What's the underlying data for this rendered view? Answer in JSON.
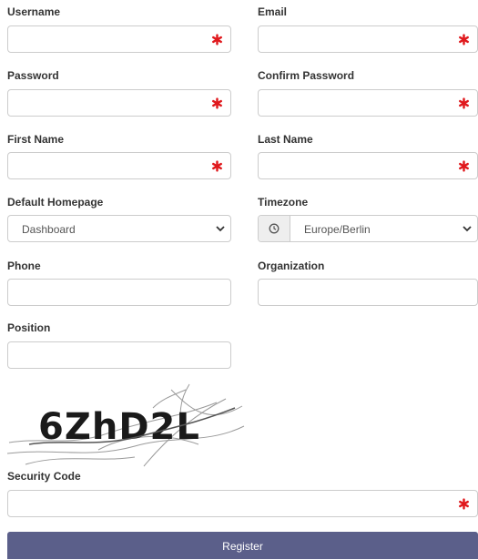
{
  "form": {
    "username_label": "Username",
    "email_label": "Email",
    "password_label": "Password",
    "confirm_password_label": "Confirm Password",
    "first_name_label": "First Name",
    "last_name_label": "Last Name",
    "default_homepage_label": "Default Homepage",
    "default_homepage_value": "Dashboard",
    "timezone_label": "Timezone",
    "timezone_value": "Europe/Berlin",
    "phone_label": "Phone",
    "organization_label": "Organization",
    "position_label": "Position",
    "captcha_text": "6ZhD2L",
    "security_code_label": "Security Code",
    "register_label": "Register"
  },
  "colors": {
    "required_marker": "#e0191d",
    "button_bg": "#5b5f8a",
    "field_border": "#cccccc"
  },
  "icons": {
    "required": "asterisk-icon",
    "timezone_addon": "clock-icon",
    "select_arrow": "chevron-down-icon"
  }
}
